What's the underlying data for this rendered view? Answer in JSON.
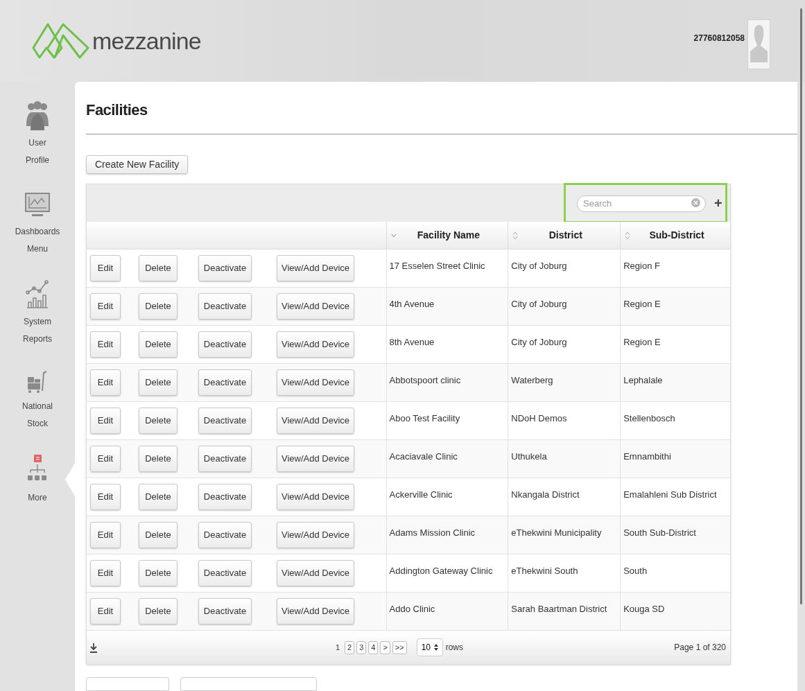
{
  "header": {
    "logo_text": "mezzanine",
    "user": "27760812058"
  },
  "sidebar": [
    {
      "kind": "users",
      "label": "User\nProfile",
      "selected": false
    },
    {
      "kind": "monitor",
      "label": "Dashboards\nMenu",
      "selected": false
    },
    {
      "kind": "reports",
      "label": "System\nReports",
      "selected": false
    },
    {
      "kind": "stock",
      "label": "National\nStock",
      "selected": false
    },
    {
      "kind": "more",
      "label": "More",
      "selected": true
    }
  ],
  "page_title": "Facilities",
  "create_button": "Create New Facility",
  "search": {
    "placeholder": "Search",
    "highlighted": true,
    "add": "+"
  },
  "table": {
    "columns": [
      {
        "label": "Facility Name",
        "sorted": true
      },
      {
        "label": "District",
        "sorted": false
      },
      {
        "label": "Sub-District",
        "sorted": false
      }
    ],
    "rows": [
      {
        "actions": [
          "Edit",
          "Delete",
          "Deactivate",
          "View/Add Device"
        ],
        "cells": [
          "17 Esselen Street Clinic",
          "City of Joburg",
          "Region F"
        ]
      },
      {
        "actions": [
          "Edit",
          "Delete",
          "Deactivate",
          "View/Add Device"
        ],
        "cells": [
          "4th Avenue",
          "City of Joburg",
          "Region E"
        ]
      },
      {
        "actions": [
          "Edit",
          "Delete",
          "Deactivate",
          "View/Add Device"
        ],
        "cells": [
          "8th Avenue",
          "City of Joburg",
          "Region E"
        ]
      },
      {
        "actions": [
          "Edit",
          "Delete",
          "Deactivate",
          "View/Add Device"
        ],
        "cells": [
          "Abbotspoort clinic",
          "Waterberg",
          "Lephalale"
        ]
      },
      {
        "actions": [
          "Edit",
          "Delete",
          "Deactivate",
          "View/Add Device"
        ],
        "cells": [
          "Aboo Test Facility",
          "NDoH Demos",
          "Stellenbosch"
        ]
      },
      {
        "actions": [
          "Edit",
          "Delete",
          "Deactivate",
          "View/Add Device"
        ],
        "cells": [
          "Acaciavale Clinic",
          "Uthukela",
          "Emnambithi"
        ]
      },
      {
        "actions": [
          "Edit",
          "Delete",
          "Deactivate",
          "View/Add Device"
        ],
        "cells": [
          "Ackerville Clinic",
          "Nkangala District",
          "Emalahleni Sub District"
        ]
      },
      {
        "actions": [
          "Edit",
          "Delete",
          "Deactivate",
          "View/Add Device"
        ],
        "cells": [
          "Adams Mission Clinic",
          "eThekwini Municipality",
          "South Sub-District"
        ]
      },
      {
        "actions": [
          "Edit",
          "Delete",
          "Deactivate",
          "View/Add Device"
        ],
        "cells": [
          "Addington Gateway Clinic",
          "eThekwini South",
          "South"
        ]
      },
      {
        "actions": [
          "Edit",
          "Delete",
          "Deactivate",
          "View/Add Device"
        ],
        "cells": [
          "Addo Clinic",
          "Sarah Baartman District",
          "Kouga SD"
        ]
      }
    ]
  },
  "footer": {
    "pages": [
      {
        "label": "1",
        "selected": true
      },
      {
        "label": "2",
        "selected": false
      },
      {
        "label": "3",
        "selected": false
      },
      {
        "label": "4",
        "selected": false
      },
      {
        "label": ">",
        "selected": false
      },
      {
        "label": ">>",
        "selected": false
      }
    ],
    "rows_per_page": "10",
    "rows_label": "rows",
    "page_info": "Page 1 of 320"
  }
}
